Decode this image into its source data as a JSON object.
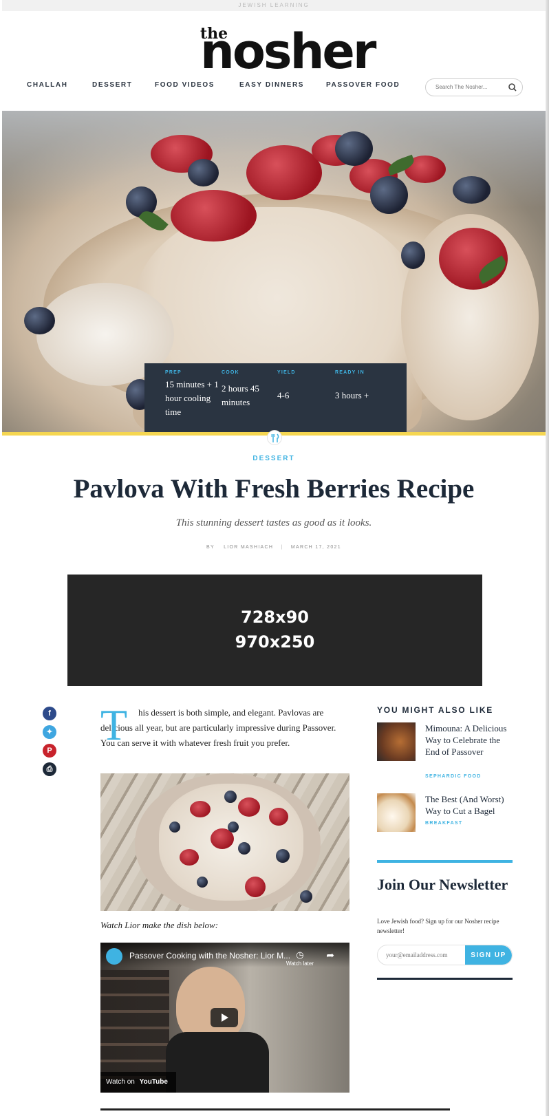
{
  "topbar": {
    "label": "JEWISH LEARNING"
  },
  "logo": {
    "small": "the",
    "main": "nosher"
  },
  "nav": {
    "items": [
      "CHALLAH",
      "DESSERT",
      "FOOD VIDEOS",
      "EASY DINNERS",
      "PASSOVER FOOD"
    ]
  },
  "search": {
    "placeholder": "Search The Nosher..."
  },
  "recipe_info": {
    "prep_label": "PREP",
    "prep_value": "15 minutes + 1 hour cooling time",
    "cook_label": "COOK",
    "cook_value": "2 hours 45 minutes",
    "yield_label": "YIELD",
    "yield_value": "4-6",
    "ready_label": "READY IN",
    "ready_value": "3 hours +"
  },
  "article": {
    "category": "DESSERT",
    "title": "Pavlova With Fresh Berries Recipe",
    "subtitle": "This stunning dessert tastes as good as it looks.",
    "by": "BY",
    "author": "LIOR MASHIACH",
    "date": "MARCH 17, 2021",
    "dropcap": "T",
    "intro": "his dessert is both simple, and elegant. Pavlovas are delicious all year, but are particularly impressive during Passover. You can serve it with whatever fresh fruit you prefer.",
    "caption": "Watch Lior make the dish below:"
  },
  "ad": {
    "line1": "728x90",
    "line2": "970x250"
  },
  "video": {
    "title": "Passover Cooking with the Nosher: Lior M...",
    "watch_later": "Watch later",
    "watch_on": "Watch on",
    "platform": "YouTube"
  },
  "sidebar": {
    "heading": "YOU MIGHT ALSO LIKE",
    "items": [
      {
        "title": "Mimouna: A Delicious Way to Celebrate the End of Passover",
        "tag": "SEPHARDIC FOOD"
      },
      {
        "title": "The Best (And Worst) Way to Cut a Bagel",
        "tag": "BREAKFAST"
      }
    ],
    "newsletter_title": "Join Our Newsletter",
    "newsletter_text": "Love Jewish food? Sign up for our Nosher recipe newsletter!",
    "email_placeholder": "your@emailaddress.com",
    "signup_label": "SIGN UP"
  },
  "colors": {
    "accent": "#3fb3e2",
    "dark": "#2a3441",
    "yellow": "#f5d651"
  },
  "social": {
    "icons": [
      "facebook-icon",
      "twitter-icon",
      "pinterest-icon",
      "print-icon"
    ]
  }
}
